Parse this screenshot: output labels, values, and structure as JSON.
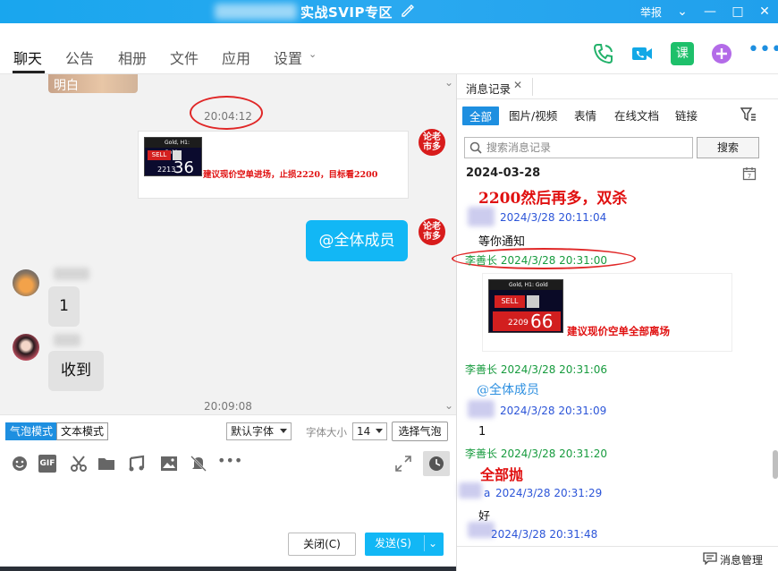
{
  "window": {
    "title": "实战SVIP专区",
    "report": "举报"
  },
  "tabs": [
    {
      "label": "聊天",
      "active": true
    },
    {
      "label": "公告"
    },
    {
      "label": "相册"
    },
    {
      "label": "文件"
    },
    {
      "label": "应用"
    },
    {
      "label": "设置"
    }
  ],
  "chat": {
    "top_partial_text": "明白",
    "time1": "20:04:12",
    "seal_text": "论老\n市多",
    "card1": {
      "sell": "SELL",
      "price_small": "2213",
      "price_big": "36",
      "note": "建议现价空单进场，止损2220，目标看2200",
      "chart_label": "Gold, H1: Gold"
    },
    "mention_all": "@全体成员",
    "msg_one": "1",
    "msg_received": "收到",
    "time2": "20:09:08"
  },
  "input": {
    "bubble_mode": "气泡模式",
    "text_mode": "文本模式",
    "font_default": "默认字体",
    "font_size_label": "字体大小",
    "font_size": "14",
    "choose_bubble": "选择气泡",
    "close_btn": "关闭(C)",
    "send_btn": "发送(S)"
  },
  "history": {
    "tab_title": "消息记录",
    "filters": [
      "全部",
      "图片/视频",
      "表情",
      "在线文档",
      "链接"
    ],
    "search_placeholder": "搜索消息记录",
    "search_btn": "搜索",
    "date": "2024-03-28",
    "line1_red": "2200然后再多，双杀",
    "msg1_time": "2024/3/28 20:11:04",
    "msg1_text": "等你通知",
    "msg2_header": "李善长 2024/3/28 20:31:00",
    "card2": {
      "sell": "SELL",
      "price_small": "2209",
      "price_big": "66",
      "note": "建议现价空单全部离场",
      "chart_label": "Gold, H1: Gold"
    },
    "msg3_header": "李善长 2024/3/28 20:31:06",
    "msg3_text": "@全体成员",
    "msg4_time": "2024/3/28 20:31:09",
    "msg4_text": "1",
    "msg5_header": "李善长 2024/3/28 20:31:20",
    "msg5_text": "全部抛",
    "msg6_prefix": "a",
    "msg6_time": "2024/3/28 20:31:29",
    "msg6_text": "好",
    "msg7_time": "2024/3/28 20:31:48",
    "manage": "消息管理"
  },
  "colors": {
    "accent": "#12b7f5",
    "titlebar": "#1fa5ee",
    "green_name": "#179b3e",
    "blue_name": "#2c55d8",
    "red_note": "#e01010"
  }
}
